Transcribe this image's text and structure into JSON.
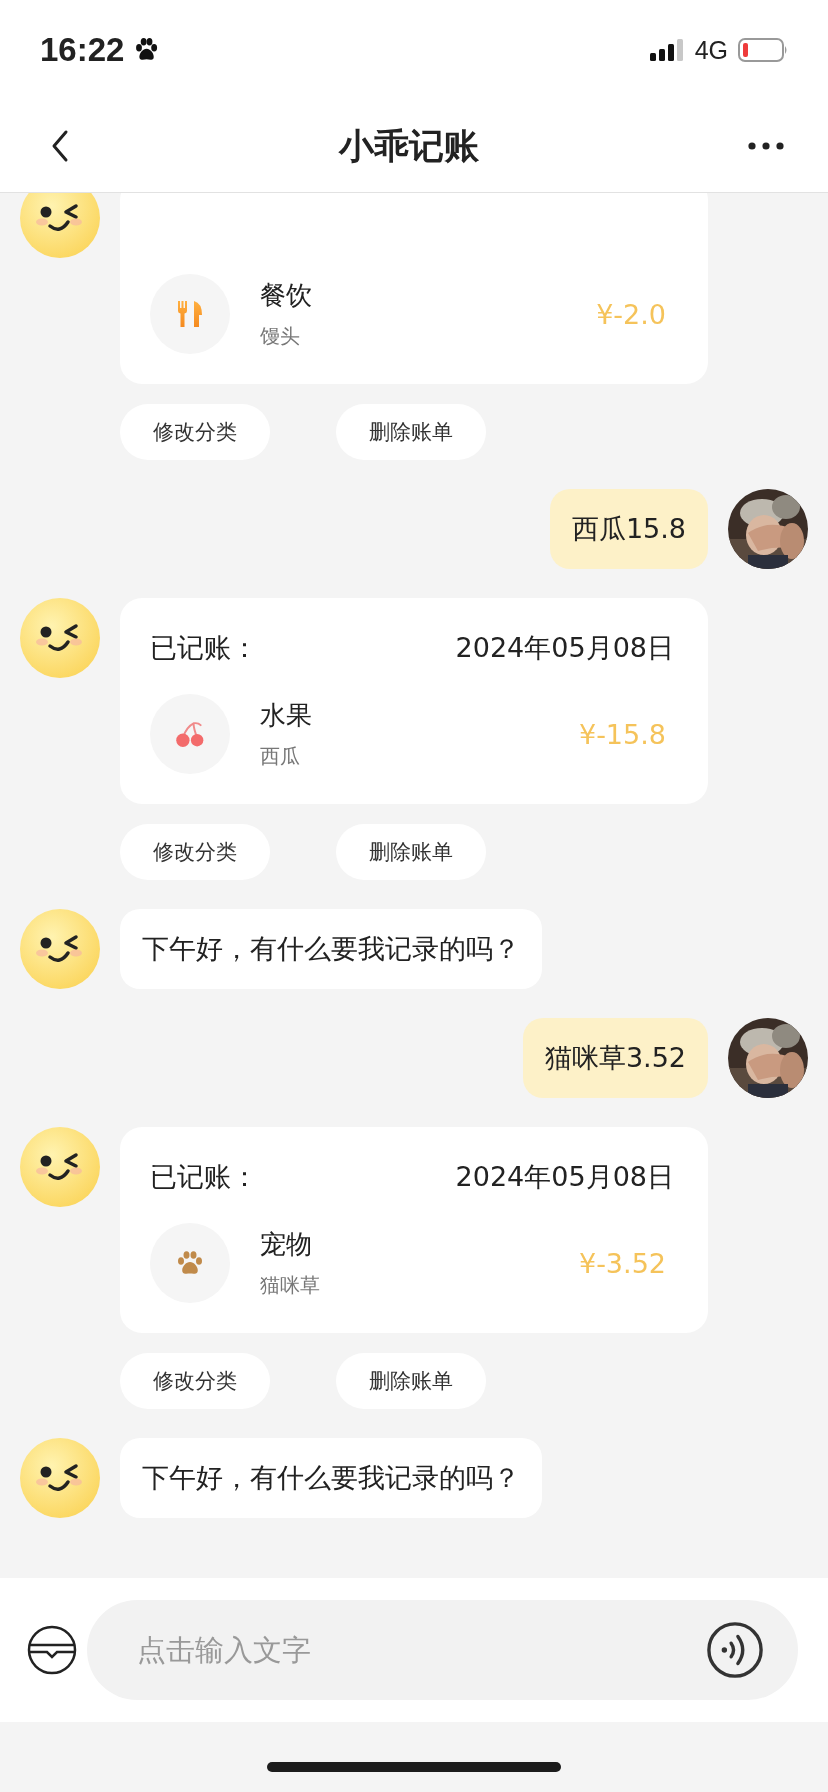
{
  "status_bar": {
    "time": "16:22",
    "network": "4G"
  },
  "nav": {
    "title": "小乖记账"
  },
  "messages": [
    {
      "kind": "record",
      "entry": {
        "kind": "dining",
        "category": "餐饮",
        "note": "馒头",
        "amount": "¥-2.0"
      },
      "actions": [
        "修改分类",
        "删除账单"
      ]
    },
    {
      "kind": "user",
      "text": "西瓜15.8"
    },
    {
      "kind": "record",
      "label": "已记账：",
      "date": "2024年05月08日",
      "entry": {
        "kind": "fruit",
        "category": "水果",
        "note": "西瓜",
        "amount": "¥-15.8"
      },
      "actions": [
        "修改分类",
        "删除账单"
      ]
    },
    {
      "kind": "bot",
      "text": "下午好，有什么要我记录的吗？"
    },
    {
      "kind": "user",
      "text": "猫咪草3.52"
    },
    {
      "kind": "record",
      "label": "已记账：",
      "date": "2024年05月08日",
      "entry": {
        "kind": "pet",
        "category": "宠物",
        "note": "猫咪草",
        "amount": "¥-3.52"
      },
      "actions": [
        "修改分类",
        "删除账单"
      ]
    },
    {
      "kind": "bot",
      "text": "下午好，有什么要我记录的吗？"
    }
  ],
  "input": {
    "placeholder": "点击输入文字"
  }
}
